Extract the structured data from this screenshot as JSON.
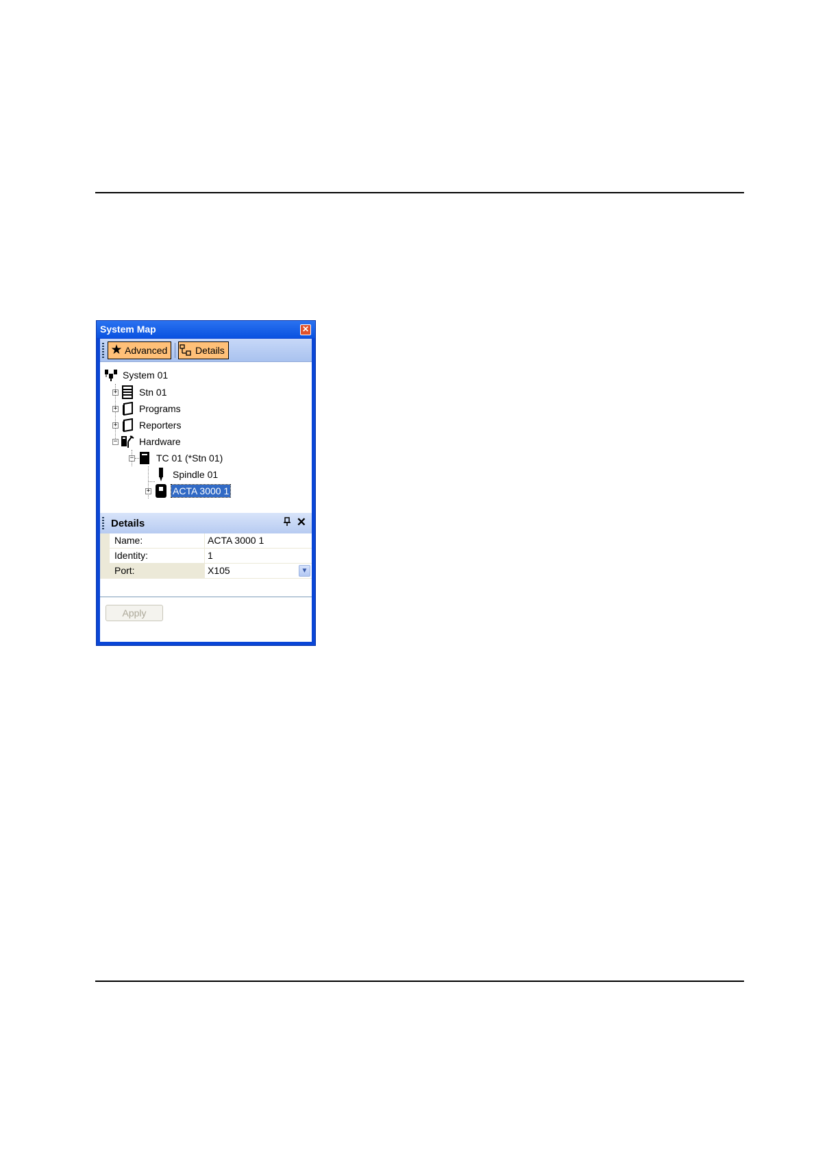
{
  "window": {
    "title": "System Map",
    "close_glyph": "✕"
  },
  "toolbar": {
    "advanced_label": "Advanced",
    "advanced_icon": "star-icon",
    "details_label": "Details",
    "details_icon": "details-tree-icon"
  },
  "tree": {
    "nodes": [
      {
        "label": "System 01",
        "icon": "system-icon",
        "expander": ""
      },
      {
        "label": "Stn 01",
        "icon": "station-icon",
        "expander": "+"
      },
      {
        "label": "Programs",
        "icon": "folder-icon",
        "expander": "+"
      },
      {
        "label": "Reporters",
        "icon": "folder-icon",
        "expander": "+"
      },
      {
        "label": "Hardware",
        "icon": "hardware-icon",
        "expander": "−"
      },
      {
        "label": "TC 01 (*Stn 01)",
        "icon": "controller-icon",
        "expander": "−"
      },
      {
        "label": "Spindle 01",
        "icon": "spindle-icon",
        "expander": ""
      },
      {
        "label": "ACTA 3000 1",
        "icon": "acta-device-icon",
        "expander": "+",
        "selected": true
      }
    ]
  },
  "details": {
    "title": "Details",
    "pin_glyph": "🖈",
    "close_glyph": "✕",
    "rows": [
      {
        "name": "Name:",
        "value": "ACTA 3000 1"
      },
      {
        "name": "Identity:",
        "value": "1"
      },
      {
        "name": "Port:",
        "value": "X105"
      }
    ],
    "dropdown_glyph": "▼",
    "apply_label": "Apply"
  },
  "colors": {
    "title_bar": "#0a52e0",
    "toolbar_button": "#ffc078",
    "selection": "#316ac5"
  }
}
